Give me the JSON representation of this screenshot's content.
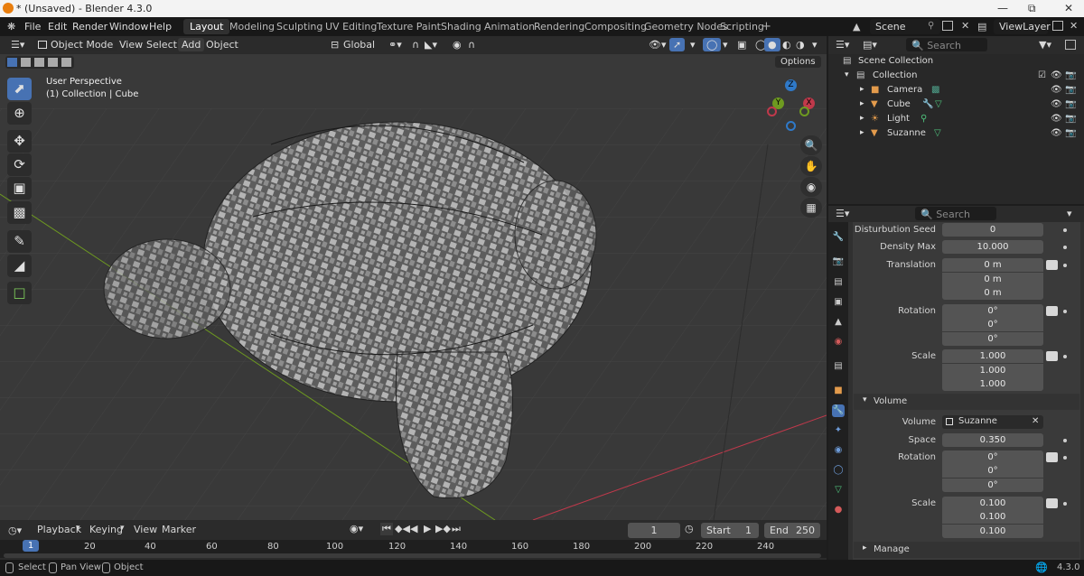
{
  "window": {
    "title": "* (Unsaved) - Blender 4.3.0"
  },
  "menu": [
    "File",
    "Edit",
    "Render",
    "Window",
    "Help"
  ],
  "workspaces": [
    "Layout",
    "Modeling",
    "Sculpting",
    "UV Editing",
    "Texture Paint",
    "Shading",
    "Animation",
    "Rendering",
    "Compositing",
    "Geometry Nodes",
    "Scripting"
  ],
  "active_workspace": "Layout",
  "scene": {
    "name": "Scene",
    "view_layer": "ViewLayer"
  },
  "viewport_header": {
    "mode": "Object Mode",
    "menus": [
      "View",
      "Select",
      "Add",
      "Object"
    ],
    "transform_orientation": "Global",
    "options_label": "Options"
  },
  "viewport_overlay": {
    "perspective": "User Perspective",
    "collection_object": "(1) Collection | Cube"
  },
  "gizmo_axes": {
    "z": "Z",
    "y": "Y",
    "x": "X"
  },
  "outliner": {
    "search_placeholder": "Search",
    "root": "Scene Collection",
    "collection": "Collection",
    "items": [
      {
        "name": "Camera",
        "icon": "camera-icon"
      },
      {
        "name": "Cube",
        "icon": "mesh-icon"
      },
      {
        "name": "Light",
        "icon": "light-icon"
      },
      {
        "name": "Suzanne",
        "icon": "mesh-icon"
      }
    ]
  },
  "properties": {
    "search_placeholder": "Search",
    "disturbution_seed": {
      "label": "Disturbution Seed",
      "value": "0"
    },
    "density_max": {
      "label": "Density Max",
      "value": "10.000"
    },
    "translation": {
      "label": "Translation",
      "values": [
        "0 m",
        "0 m",
        "0 m"
      ]
    },
    "rotation": {
      "label": "Rotation",
      "values": [
        "0°",
        "0°",
        "0°"
      ]
    },
    "scale": {
      "label": "Scale",
      "values": [
        "1.000",
        "1.000",
        "1.000"
      ]
    },
    "volume_panel": "Volume",
    "volume": {
      "label": "Volume",
      "object": "Suzanne"
    },
    "space": {
      "label": "Space",
      "value": "0.350"
    },
    "vol_rotation": {
      "label": "Rotation",
      "values": [
        "0°",
        "0°",
        "0°"
      ]
    },
    "vol_scale": {
      "label": "Scale",
      "values": [
        "0.100",
        "0.100",
        "0.100"
      ]
    },
    "manage_panel": "Manage"
  },
  "timeline": {
    "menus": [
      "Playback",
      "Keying",
      "View",
      "Marker"
    ],
    "current_frame": "1",
    "start_label": "Start",
    "start": "1",
    "end_label": "End",
    "end": "250",
    "ticks": [
      "1",
      "20",
      "40",
      "60",
      "80",
      "100",
      "120",
      "140",
      "160",
      "180",
      "200",
      "220",
      "240"
    ]
  },
  "statusbar": {
    "select": "Select",
    "pan": "Pan View",
    "object": "Object",
    "version": "4.3.0"
  },
  "colors": {
    "accent": "#4772b3",
    "x_axis": "#c0394b",
    "y_axis": "#6e9a20",
    "z_axis": "#2f79c8",
    "background": "#393939"
  }
}
